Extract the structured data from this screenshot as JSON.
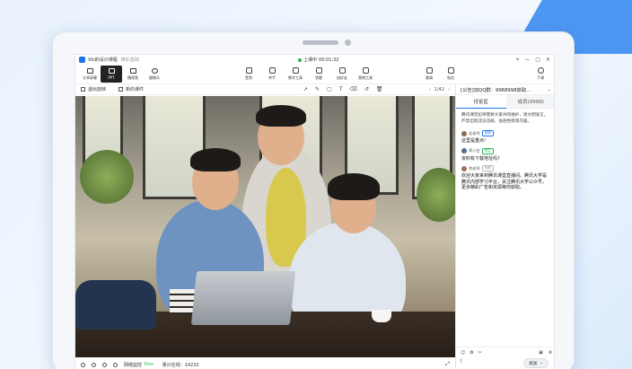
{
  "app": {
    "title": "Vki的设计课程",
    "subtitle": "精彩基础"
  },
  "live": {
    "status_label": "上课中",
    "timer": "00:01:32"
  },
  "modes": [
    {
      "label": "分享屏幕",
      "icon": "screen-share-icon"
    },
    {
      "label": "PPT",
      "icon": "ppt-icon",
      "active": true
    },
    {
      "label": "播视频",
      "icon": "video-icon"
    },
    {
      "label": "摄像头",
      "icon": "camera-icon"
    }
  ],
  "tools": [
    {
      "label": "签到",
      "icon": "checkin-icon"
    },
    {
      "label": "举手",
      "icon": "raise-hand-icon"
    },
    {
      "label": "教学工具",
      "icon": "teaching-tools-icon"
    },
    {
      "label": "答题",
      "icon": "quiz-icon"
    },
    {
      "label": "加好友",
      "icon": "add-friend-icon"
    },
    {
      "label": "营销工具",
      "icon": "marketing-tools-icon"
    }
  ],
  "right_tools": [
    {
      "label": "邀请",
      "icon": "invite-icon"
    },
    {
      "label": "私信",
      "icon": "message-icon"
    },
    {
      "label": "下课",
      "icon": "end-class-icon"
    }
  ],
  "subbar": {
    "exit_label": "退出放映",
    "new_label": "新的课件",
    "page": "1/42"
  },
  "status": {
    "network_label": "网络监控",
    "network_value": "3ms",
    "total_label": "累计在线：14232"
  },
  "chat": {
    "notice": "[公告]加QQ群：9968998获取...",
    "tab_discuss": "讨论区",
    "tab_members": "成员(9999)",
    "system_message": "腾讯课堂纪律需要大家共同维护，请文明发言。严禁出现违法违规、低俗色情等内容。",
    "messages": [
      {
        "name": "吴老师",
        "badge": "老师",
        "badge_type": "teacher",
        "text": "这里是重点!"
      },
      {
        "name": "周小白",
        "badge": "学生",
        "badge_type": "student",
        "text": "资料有下载地址吗?"
      },
      {
        "name": "李老师",
        "badge": "助教",
        "badge_type": "assist",
        "text": "欢迎大家来到腾讯课堂直播间。腾讯大学是腾讯内部学习平台，关注腾讯大学公众号，更多精彩广告和资源等你获取。"
      }
    ],
    "send_label": "发送"
  },
  "colors": {
    "accent": "#1a73e8",
    "live_green": "#22b14c"
  }
}
